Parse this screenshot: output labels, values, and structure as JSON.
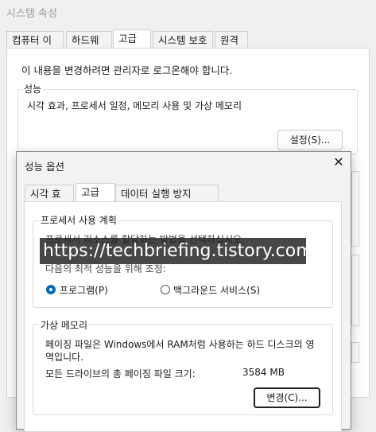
{
  "back_window": {
    "title": "시스템 속성",
    "tabs": [
      "컴퓨터 이름",
      "하드웨어",
      "고급",
      "시스템 보호",
      "원격"
    ],
    "admin_notice": "이 내용을 변경하려면 관리자로 로그온해야 합니다.",
    "performance_group": {
      "title": "성능",
      "description": "시각 효과, 프로세서 일정, 메모리 사용 및 가상 메모리",
      "settings_button": "설정(S)..."
    }
  },
  "dialog": {
    "title": "성능 옵션",
    "tabs": [
      "시각 효과",
      "고급",
      "데이터 실행 방지(DEP)"
    ],
    "processor_group": {
      "title": "프로세서 사용 계획",
      "line1": "프로세서 리소스를 할당하는 방법을 선택하십시오.",
      "line2": "다음의 최적 성능을 위해 조정:",
      "options": [
        {
          "label": "프로그램(P)",
          "selected": true
        },
        {
          "label": "백그라운드 서비스(S)",
          "selected": false
        }
      ]
    },
    "virtual_memory_group": {
      "title": "가상 메모리",
      "description": "페이징 파일은 Windows에서 RAM처럼 사용하는 하드 디스크의 영역입니다.",
      "total_label": "모든 드라이브의 총 페이징 파일 크기:",
      "total_value": "3584 MB",
      "change_button": "변경(C)..."
    }
  },
  "watermark": "https://techbriefing.tistory.com",
  "colors": {
    "accent": "#0067c0",
    "window_bg": "#f0f0f0",
    "panel_bg": "#ffffff"
  }
}
